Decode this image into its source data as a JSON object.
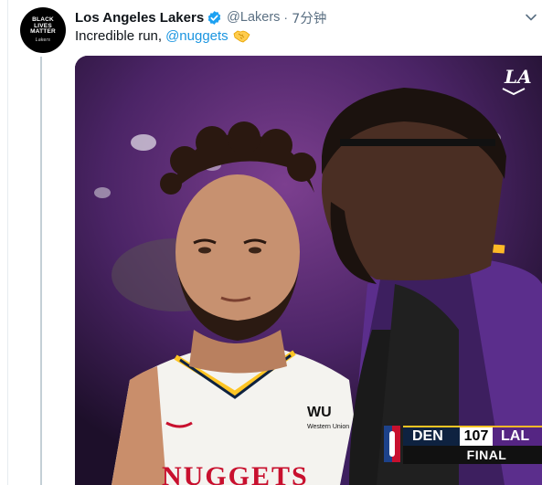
{
  "tweet": {
    "author_name": "Los Angeles Lakers",
    "handle": "@Lakers",
    "separator": "·",
    "time": "7分钟",
    "text": "Incredible run,",
    "mention": "@nuggets",
    "emoji": "handshake",
    "avatar_text": [
      "BLACK",
      "LIVES",
      "MATTER"
    ],
    "avatar_signature": "Lakers"
  },
  "media": {
    "watermark": "LA",
    "jersey_sponsor": "WU",
    "jersey_sponsor_sub": "Western Union",
    "jersey_text": "NUGGETS"
  },
  "scorebug": {
    "team1": "DEN",
    "score1": "107",
    "team2": "LAL",
    "status": "FINAL"
  },
  "colors": {
    "link": "#1b95e0",
    "verified": "#1da1f2",
    "lakers_purple": "#552583",
    "lakers_gold": "#fdb927",
    "nuggets_navy": "#0e2240"
  }
}
